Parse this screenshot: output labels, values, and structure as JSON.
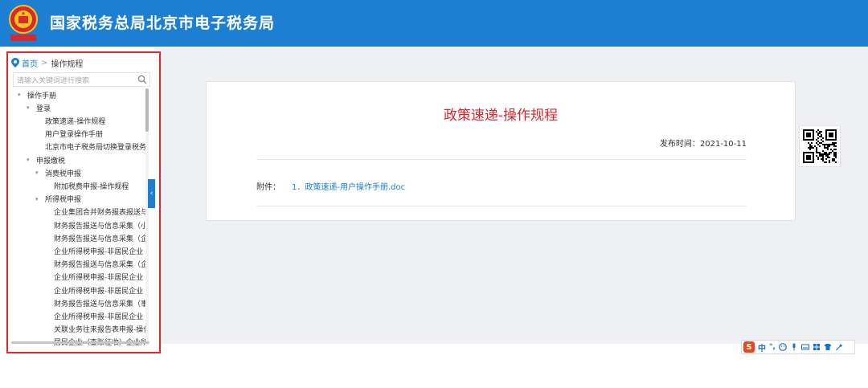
{
  "header": {
    "title": "国家税务总局北京市电子税务局"
  },
  "breadcrumb": {
    "home": "首页",
    "separator": "》",
    "current": "操作规程"
  },
  "search": {
    "placeholder": "请输入关键词进行搜索"
  },
  "tree": [
    {
      "label": "操作手册",
      "level": 0,
      "expanded": true
    },
    {
      "label": "登录",
      "level": 1,
      "expanded": true
    },
    {
      "label": "政策速递-操作规程",
      "level": 2
    },
    {
      "label": "用户登录操作手册",
      "level": 2
    },
    {
      "label": "北京市电子税务局切换登录税务",
      "level": 2
    },
    {
      "label": "申报缴税",
      "level": 1,
      "expanded": true
    },
    {
      "label": "消费税申报",
      "level": 2,
      "expanded": true
    },
    {
      "label": "附加税费申报-操作规程",
      "level": 3
    },
    {
      "label": "所得税申报",
      "level": 2,
      "expanded": true
    },
    {
      "label": "企业集团合并财务报表报送与",
      "level": 3
    },
    {
      "label": "财务报告报送与信息采集（小",
      "level": 3
    },
    {
      "label": "财务报告报送与信息采集（企",
      "level": 3
    },
    {
      "label": "企业所得税申报-非居民企业",
      "level": 3
    },
    {
      "label": "财务报告报送与信息采集（企",
      "level": 3
    },
    {
      "label": "企业所得税申报-非居民企业",
      "level": 3
    },
    {
      "label": "企业所得税申报-非居民企业",
      "level": 3
    },
    {
      "label": "财务报告报送与信息采集（事",
      "level": 3
    },
    {
      "label": "企业所得税申报-非居民企业",
      "level": 3
    },
    {
      "label": "关联业务往来报告表申报-操作",
      "level": 3
    },
    {
      "label": "居民企业（查账征收）企业所",
      "level": 3
    }
  ],
  "article": {
    "title": "政策速递-操作规程",
    "date_label": "发布时间：",
    "date": "2021-10-11",
    "attachment_label": "附件：",
    "attachment_link": "1．政策速递-用户操作手册.doc"
  },
  "ime": {
    "logo": "S",
    "mode": "中",
    "punct": "°,"
  },
  "colors": {
    "header_bg": "#1c7fd1",
    "title_red": "#d9282e",
    "link_blue": "#1c7fd1",
    "highlight_border": "#e0262a"
  },
  "icons": [
    "emblem-icon",
    "location-pin-icon",
    "search-icon",
    "collapse-arrow-icon",
    "qr-code-icon",
    "sogou-logo-icon",
    "emoji-icon",
    "microphone-icon",
    "keyboard-icon",
    "grid-icon",
    "shirt-icon",
    "wrench-icon"
  ]
}
